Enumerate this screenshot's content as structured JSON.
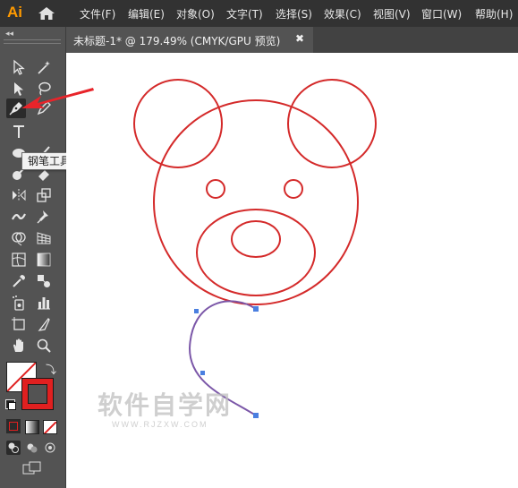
{
  "app": {
    "logo": "Ai",
    "menus": [
      "文件(F)",
      "编辑(E)",
      "对象(O)",
      "文字(T)",
      "选择(S)",
      "效果(C)",
      "视图(V)",
      "窗口(W)",
      "帮助(H)"
    ]
  },
  "document": {
    "tab_title": "未标题-1* @ 179.49% (CMYK/GPU 预览)",
    "close_glyph": "✖"
  },
  "toolbar": {
    "collapse_glyph": "◂◂",
    "tooltip": "钢笔工具 (P)",
    "active_tool": "pen-tool",
    "fill_color": "#ffffff",
    "stroke_color": "#e02020"
  },
  "artwork": {
    "stroke_color": "#d42a2a",
    "path_color": "#7b57a8",
    "anchor_color": "#4a7fe0"
  },
  "watermark": {
    "main": "软件自学网",
    "url": "WWW.RJZXW.COM"
  }
}
